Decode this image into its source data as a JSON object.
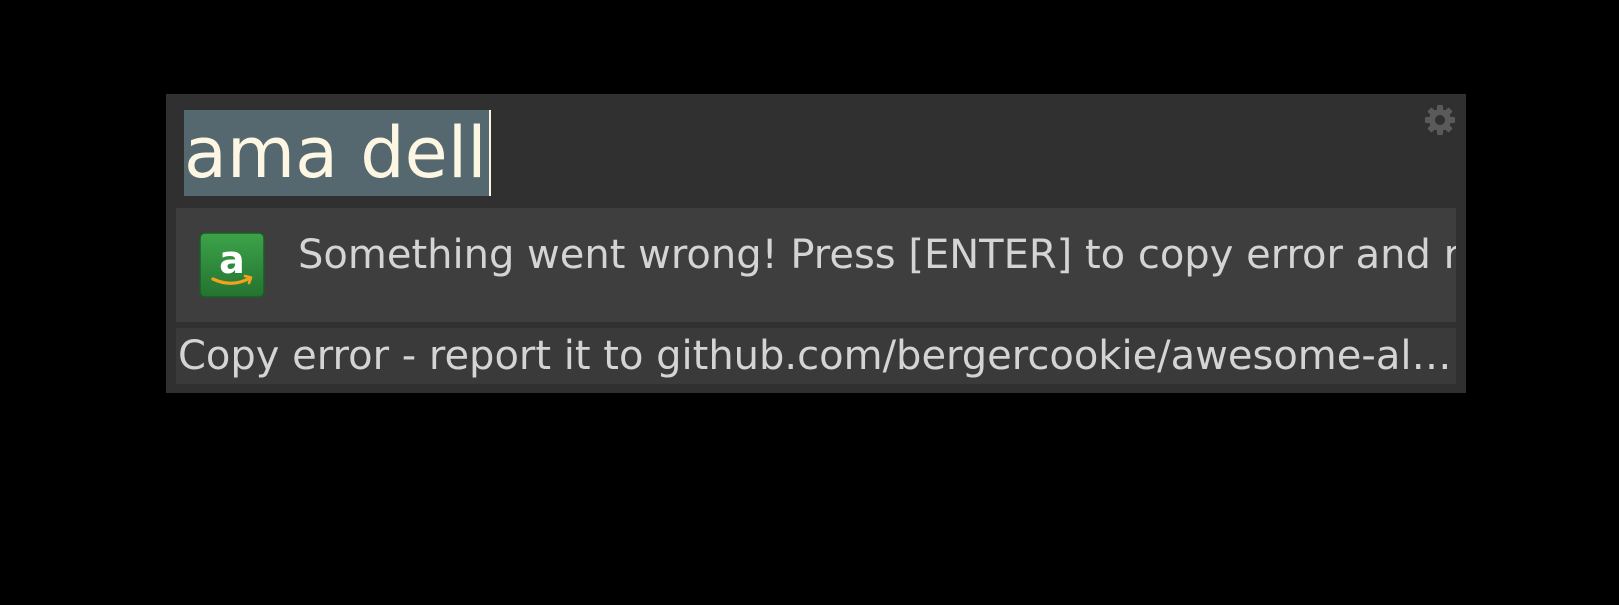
{
  "search": {
    "query": "ama dell"
  },
  "results": [
    {
      "icon": "amazon-icon",
      "title": "Something went wrong! Press [ENTER] to copy error and report it"
    }
  ],
  "actions": [
    {
      "label": "Copy error - report it to github.com/bergercookie/awesome-albert-plugins"
    }
  ],
  "colors": {
    "background": "#000000",
    "panel": "#303030",
    "item": "#3e3e3e",
    "selection": "#56686f",
    "query_text": "#fdf6e3",
    "item_text": "#d4d4d4",
    "icon_green": "#2e8b3e"
  },
  "icons": {
    "settings": "gear-icon",
    "result": "amazon-icon"
  }
}
